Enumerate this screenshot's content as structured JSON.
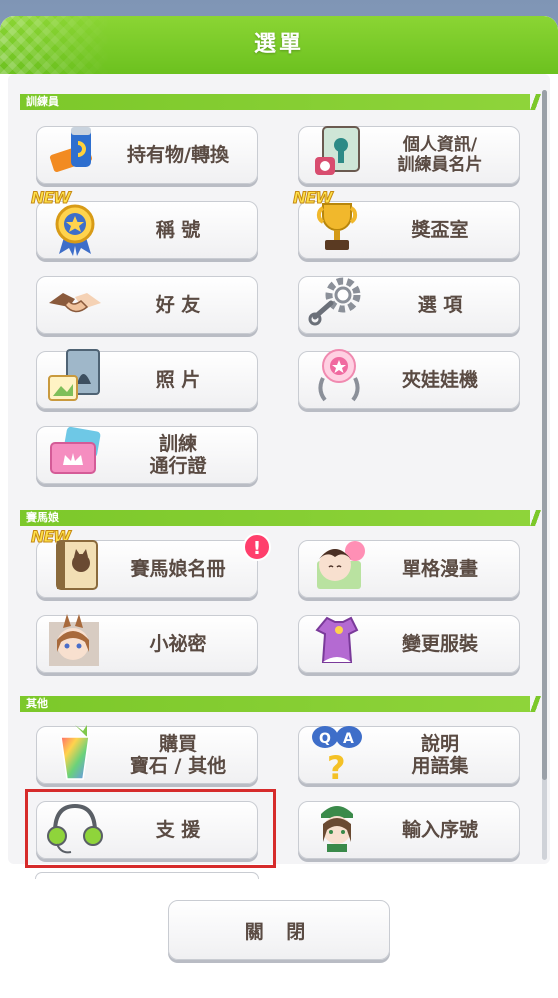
{
  "dialog": {
    "title": "選單",
    "close_label": "關 閉"
  },
  "sections": [
    {
      "label": "訓練員",
      "items": [
        {
          "label": "持有物/轉換",
          "icon": "items-exchange-icon",
          "new": false
        },
        {
          "label": "個人資訊/\n訓練員名片",
          "icon": "profile-card-icon",
          "new": false
        },
        {
          "label": "稱 號",
          "icon": "title-badge-icon",
          "new": true
        },
        {
          "label": "獎盃室",
          "icon": "trophy-icon",
          "new": true
        },
        {
          "label": "好 友",
          "icon": "handshake-icon",
          "new": false
        },
        {
          "label": "選 項",
          "icon": "gear-icon",
          "new": false
        },
        {
          "label": "照 片",
          "icon": "photo-icon",
          "new": false
        },
        {
          "label": "夾娃娃機",
          "icon": "claw-machine-icon",
          "new": false
        },
        {
          "label": "訓練\n通行證",
          "icon": "pass-ticket-icon",
          "new": false
        }
      ]
    },
    {
      "label": "賽馬娘",
      "items": [
        {
          "label": "賽馬娘名冊",
          "icon": "roster-icon",
          "new": true,
          "notice": "!"
        },
        {
          "label": "單格漫畫",
          "icon": "comic-icon",
          "new": false
        },
        {
          "label": "小祕密",
          "icon": "secret-icon",
          "new": false
        },
        {
          "label": "變更服裝",
          "icon": "outfit-icon",
          "new": false
        }
      ]
    },
    {
      "label": "其他",
      "items": [
        {
          "label": "購買\n寶石 / 其他",
          "icon": "gem-icon",
          "new": false
        },
        {
          "label": "說明\n用語集",
          "icon": "help-qa-icon",
          "new": false
        },
        {
          "label": "支 援",
          "icon": "headset-icon",
          "new": false
        },
        {
          "label": "輸入序號",
          "icon": "serial-code-icon",
          "new": false
        }
      ]
    }
  ],
  "badge_text": "NEW",
  "colors": {
    "accent": "#7cc82a",
    "highlight": "#d62b2b",
    "text": "#5a4b43"
  }
}
